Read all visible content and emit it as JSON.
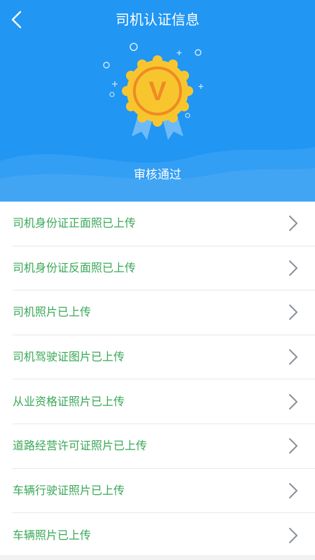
{
  "header": {
    "title": "司机认证信息",
    "status": "审核通过",
    "badge_letter": "V",
    "back_icon": "chevron-left-icon"
  },
  "colors": {
    "header_bg": "#2196f3",
    "label_green": "#3aa757",
    "badge_gold": "#f7c62f",
    "badge_orange": "#f08a24"
  },
  "list": {
    "items": [
      {
        "label": "司机身份证正面照已上传"
      },
      {
        "label": "司机身份证反面照已上传"
      },
      {
        "label": "司机照片已上传"
      },
      {
        "label": "司机驾驶证图片已上传"
      },
      {
        "label": "从业资格证照片已上传"
      },
      {
        "label": "道路经营许可证照片已上传"
      },
      {
        "label": "车辆行驶证照片已上传"
      },
      {
        "label": "车辆照片已上传"
      }
    ]
  }
}
